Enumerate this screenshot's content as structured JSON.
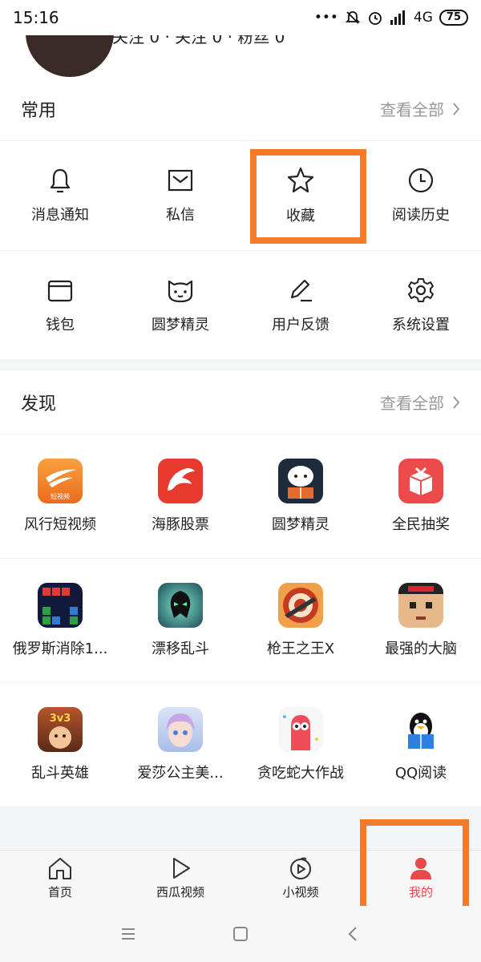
{
  "status_bar": {
    "time": "15:16",
    "dots": "•••",
    "network": "4G",
    "battery": "75",
    "icons": [
      "mute-icon",
      "alarm-icon",
      "signal-icon"
    ]
  },
  "profile": {
    "stats_text": "关注 0 · 关注 0 · 粉丝 0"
  },
  "common": {
    "title": "常用",
    "view_all": "查看全部",
    "items": [
      {
        "label": "消息通知",
        "icon": "bell-icon"
      },
      {
        "label": "私信",
        "icon": "mail-icon"
      },
      {
        "label": "收藏",
        "icon": "star-icon"
      },
      {
        "label": "阅读历史",
        "icon": "clock-icon"
      },
      {
        "label": "钱包",
        "icon": "wallet-icon"
      },
      {
        "label": "圆梦精灵",
        "icon": "cat-face-icon"
      },
      {
        "label": "用户反馈",
        "icon": "pen-icon"
      },
      {
        "label": "系统设置",
        "icon": "gear-icon"
      }
    ]
  },
  "discover": {
    "title": "发现",
    "view_all": "查看全部",
    "items": [
      {
        "label": "风行短视频",
        "icon": "fengxing-app-icon",
        "color": "#f5821f",
        "badge": "短视频"
      },
      {
        "label": "海豚股票",
        "icon": "dolphin-app-icon",
        "color": "#e8392f"
      },
      {
        "label": "圆梦精灵",
        "icon": "sheep-reading-app-icon",
        "color": "#1d2b3a"
      },
      {
        "label": "全民抽奖",
        "icon": "gift-box-app-icon",
        "color": "#ec4b4b"
      },
      {
        "label": "俄罗斯消除1...",
        "icon": "tetris-app-icon",
        "color": "#1a2a5c"
      },
      {
        "label": "漂移乱斗",
        "icon": "drift-brawl-app-icon",
        "color": "#1d4a5a"
      },
      {
        "label": "枪王之王X",
        "icon": "target-gun-app-icon",
        "color": "#e0762a"
      },
      {
        "label": "最强的大脑",
        "icon": "brain-face-app-icon",
        "color": "#d9a36a"
      },
      {
        "label": "乱斗英雄",
        "icon": "hero-app-icon",
        "color": "#7a3f22",
        "badge": "3v3"
      },
      {
        "label": "爱莎公主美...",
        "icon": "princess-app-icon",
        "color": "#b8c8e8"
      },
      {
        "label": "贪吃蛇大作战",
        "icon": "snake-app-icon",
        "color": "#f4f4f4"
      },
      {
        "label": "QQ阅读",
        "icon": "qq-penguin-app-icon",
        "color": "#ffffff"
      }
    ]
  },
  "tabbar": {
    "tabs": [
      {
        "label": "首页",
        "icon": "home-icon"
      },
      {
        "label": "西瓜视频",
        "icon": "play-icon"
      },
      {
        "label": "小视频",
        "icon": "short-video-icon"
      },
      {
        "label": "我的",
        "icon": "person-icon",
        "active": true
      }
    ]
  },
  "colors": {
    "accent": "#e84a4a",
    "highlight": "#f47b2c"
  }
}
